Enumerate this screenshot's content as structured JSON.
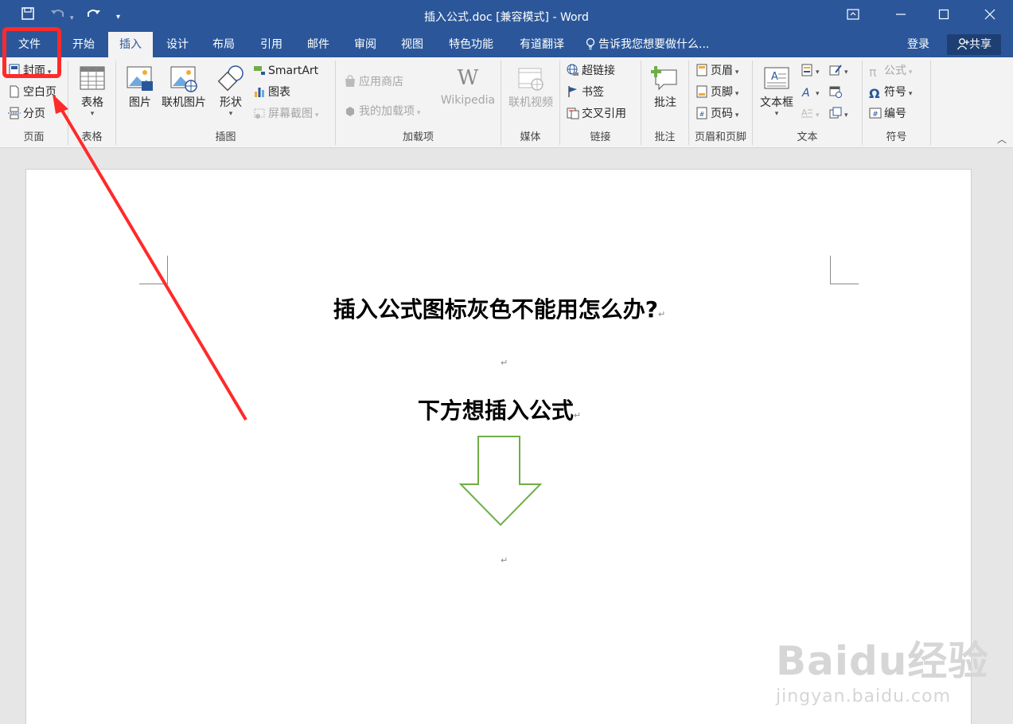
{
  "window": {
    "title": "插入公式.doc [兼容模式] - Word"
  },
  "tabs": [
    {
      "label": "文件"
    },
    {
      "label": "开始"
    },
    {
      "label": "插入"
    },
    {
      "label": "设计"
    },
    {
      "label": "布局"
    },
    {
      "label": "引用"
    },
    {
      "label": "邮件"
    },
    {
      "label": "审阅"
    },
    {
      "label": "视图"
    },
    {
      "label": "特色功能"
    },
    {
      "label": "有道翻译"
    }
  ],
  "tell_me": "告诉我您想要做什么...",
  "account": {
    "signin": "登录",
    "share": "共享"
  },
  "ribbon": {
    "pages": {
      "label": "页面",
      "cover": "封面",
      "blank": "空白页",
      "break": "分页"
    },
    "tables": {
      "label": "表格",
      "table": "表格"
    },
    "illustrations": {
      "label": "插图",
      "pictures": "图片",
      "online_pictures": "联机图片",
      "shapes": "形状",
      "smartart": "SmartArt",
      "chart": "图表",
      "screenshot": "屏幕截图"
    },
    "addins": {
      "label": "加载项",
      "store": "应用商店",
      "my_addins": "我的加载项",
      "wikipedia": "Wikipedia"
    },
    "media": {
      "label": "媒体",
      "online_video": "联机视频"
    },
    "links": {
      "label": "链接",
      "hyperlink": "超链接",
      "bookmark": "书签",
      "cross_ref": "交叉引用"
    },
    "comments": {
      "label": "批注",
      "comment": "批注"
    },
    "header_footer": {
      "label": "页眉和页脚",
      "header": "页眉",
      "footer": "页脚",
      "page_number": "页码"
    },
    "text": {
      "label": "文本",
      "textbox": "文本框"
    },
    "symbols": {
      "label": "符号",
      "equation": "公式",
      "symbol": "符号",
      "number": "编号"
    }
  },
  "document": {
    "heading1": "插入公式图标灰色不能用怎么办?",
    "heading2": "下方想插入公式",
    "para_mark": "↵"
  },
  "watermark": {
    "main": "Baidu经验",
    "url": "jingyan.baidu.com"
  },
  "colors": {
    "accent": "#2b579a",
    "highlight": "#ff2a2a",
    "arrow_shape": "#70ad47"
  }
}
